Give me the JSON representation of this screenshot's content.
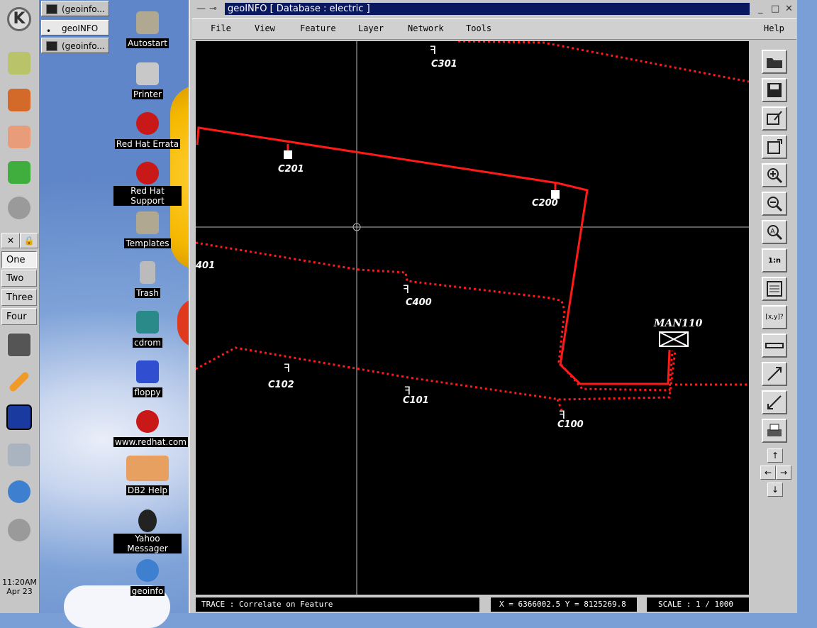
{
  "panel": {
    "desktops": [
      "One",
      "Two",
      "Three",
      "Four"
    ],
    "clock_time": "11:20AM",
    "clock_date": "Apr 23"
  },
  "taskbar": {
    "items": [
      "(geoinfo...",
      "geoINFO ...",
      "(geoinfo..."
    ]
  },
  "desktop_icons": [
    "Autostart",
    "Printer",
    "Red Hat Errata",
    "Red Hat Support",
    "Templates",
    "Trash",
    "cdrom",
    "floppy",
    "www.redhat.com",
    "DB2 Help",
    "Yahoo Messager",
    "geoinfo"
  ],
  "window": {
    "title": "geoINFO  [ Database : electric ]",
    "menu": [
      "File",
      "View",
      "Feature",
      "Layer",
      "Network",
      "Tools",
      "Help"
    ]
  },
  "map": {
    "labels": {
      "c301": "C301",
      "c201": "C201",
      "c200": "C200",
      "c401": "401",
      "c400": "C400",
      "c102": "C102",
      "c101": "C101",
      "c100": "C100",
      "man110": "MAN110"
    }
  },
  "toolbar": {
    "scale_icon_text": "1:n",
    "xy_icon_text": "[x,y]?"
  },
  "status": {
    "mode": "TRACE : Correlate on Feature",
    "coords": "X = 6366002.5    Y = 8125269.8",
    "scale": "SCALE :  1 / 1000"
  },
  "colors": {
    "network_line": "#ff1a1a",
    "map_background": "#000000",
    "title_bar": "#0a1860"
  }
}
